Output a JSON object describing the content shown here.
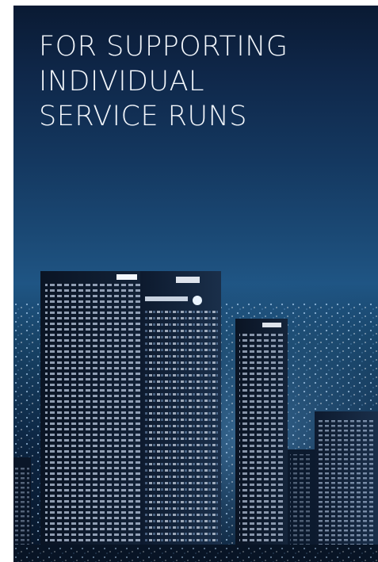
{
  "headline": {
    "lines": [
      "FOR SUPPORTING",
      "INDIVIDUAL",
      "SERVICE RUNS"
    ]
  },
  "image": {
    "subject": "night-city-skyline",
    "palette": {
      "sky_top": "#0a1a33",
      "sky_mid": "#1f5584",
      "building": "#0b1626",
      "window_light": "#dceaff"
    }
  }
}
